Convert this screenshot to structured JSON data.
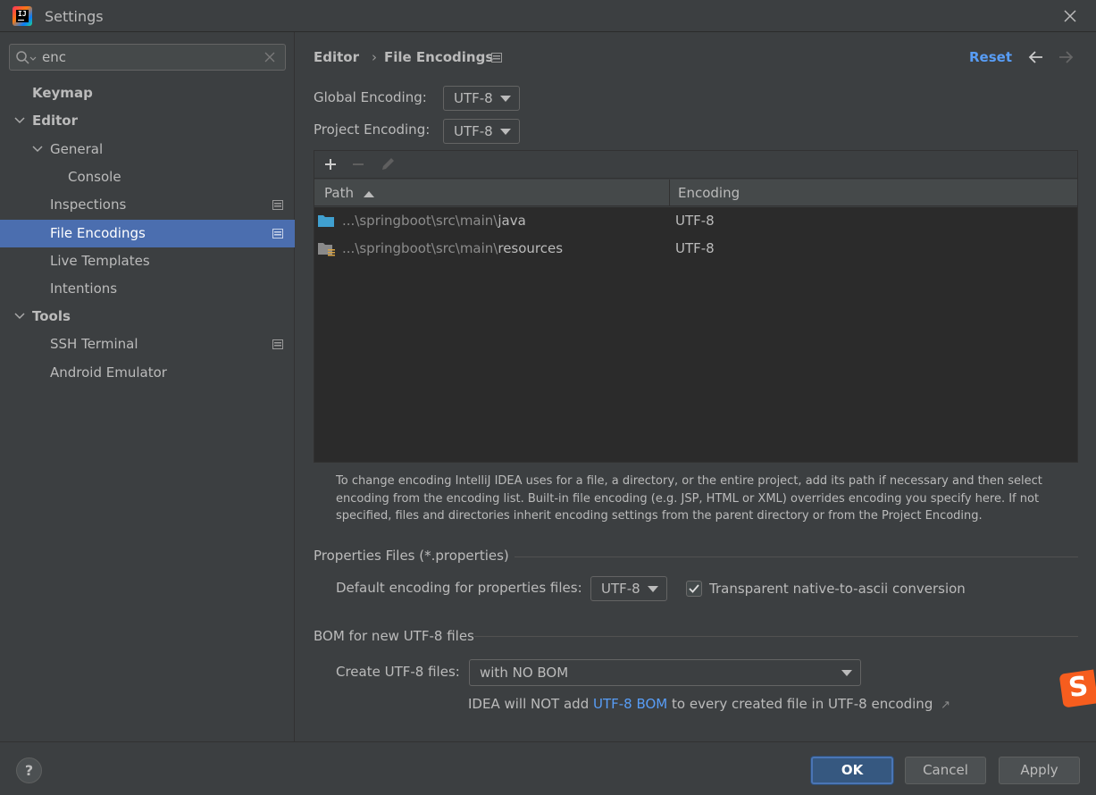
{
  "window": {
    "title": "Settings"
  },
  "search": {
    "value": "enc"
  },
  "sidebar": {
    "items": [
      {
        "label": "Keymap"
      },
      {
        "label": "Editor"
      },
      {
        "label": "General"
      },
      {
        "label": "Console"
      },
      {
        "label": "Inspections"
      },
      {
        "label": "File Encodings"
      },
      {
        "label": "Live Templates"
      },
      {
        "label": "Intentions"
      },
      {
        "label": "Tools"
      },
      {
        "label": "SSH Terminal"
      },
      {
        "label": "Android Emulator"
      }
    ]
  },
  "header": {
    "breadcrumb": [
      "Editor",
      "File Encodings"
    ],
    "separator": "›",
    "reset_label": "Reset"
  },
  "encodings": {
    "global_label": "Global Encoding:",
    "global_value": "UTF-8",
    "project_label": "Project Encoding:",
    "project_value": "UTF-8"
  },
  "table": {
    "columns": [
      "Path",
      "Encoding"
    ],
    "rows": [
      {
        "path_prefix": "...\\springboot\\src\\main\\",
        "path_leaf": "java",
        "encoding": "UTF-8",
        "icon": "folder-icon"
      },
      {
        "path_prefix": "...\\springboot\\src\\main\\",
        "path_leaf": "resources",
        "encoding": "UTF-8",
        "icon": "resources-folder-icon"
      }
    ]
  },
  "help_text": "To change encoding IntelliJ IDEA uses for a file, a directory, or the entire project, add its path if necessary and then select encoding from the encoding list. Built-in file encoding (e.g. JSP, HTML or XML) overrides encoding you specify here. If not specified, files and directories inherit encoding settings from the parent directory or from the Project Encoding.",
  "properties": {
    "section_title": "Properties Files (*.properties)",
    "default_label": "Default encoding for properties files:",
    "default_value": "UTF-8",
    "native_ascii_label": "Transparent native-to-ascii conversion",
    "native_ascii_checked": true
  },
  "bom": {
    "section_title": "BOM for new UTF-8 files",
    "create_label": "Create UTF-8 files:",
    "create_value": "with NO BOM",
    "note_prefix": "IDEA will NOT add ",
    "note_link": "UTF-8 BOM",
    "note_suffix": " to every created file in UTF-8 encoding",
    "note_arrow": "↗"
  },
  "footer": {
    "help_label": "?",
    "ok_label": "OK",
    "cancel_label": "Cancel",
    "apply_label": "Apply"
  },
  "colors": {
    "background": "#3c3f41",
    "selection": "#4b6eaf",
    "link": "#589df6",
    "table_bg": "#2b2b2b"
  }
}
